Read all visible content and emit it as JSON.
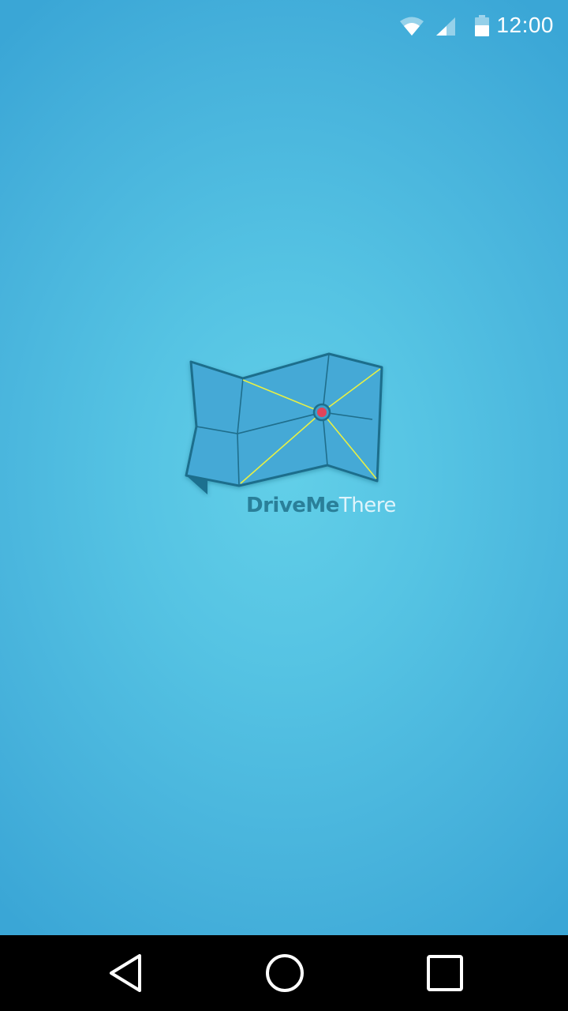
{
  "status_bar": {
    "time": "12:00",
    "icons": [
      "wifi-icon",
      "cellular-signal-icon",
      "battery-icon"
    ]
  },
  "splash": {
    "logo_word_primary": "DriveMe",
    "logo_word_secondary": "There",
    "logo_icon": "folded-map-icon"
  },
  "nav_bar": {
    "buttons": [
      "back-icon",
      "home-icon",
      "recents-icon"
    ]
  },
  "colors": {
    "background": "#55c3e3",
    "map_fill": "#45a9d6",
    "map_stroke": "#1f6e8c",
    "route_lines": "#e8f044",
    "pin": "#e0455a",
    "wordmark_primary": "#2a7f99",
    "wordmark_secondary": "#dff4fb",
    "nav_bar": "#000000"
  }
}
